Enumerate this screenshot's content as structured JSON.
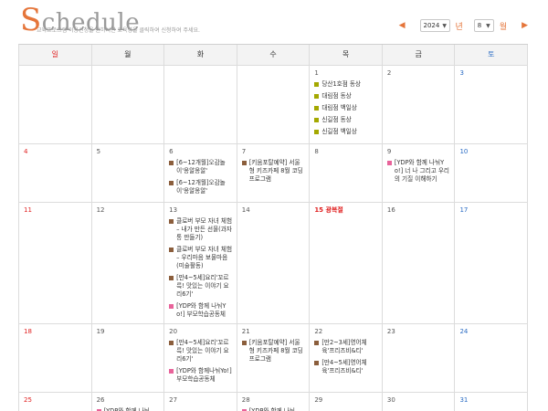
{
  "header": {
    "title_first": "S",
    "title_rest": "chedule",
    "subtitle": "교육프로그램 이용신청을 원하시면 교육명을 클릭하여 신청하여 주세요."
  },
  "nav": {
    "prev": "◀",
    "next": "▶",
    "year": "2024",
    "year_unit": "년",
    "month": "8",
    "month_unit": "월"
  },
  "weekdays": [
    "일",
    "월",
    "화",
    "수",
    "목",
    "금",
    "토"
  ],
  "weeks": [
    [
      {
        "day": "",
        "events": []
      },
      {
        "day": "",
        "events": []
      },
      {
        "day": "",
        "events": []
      },
      {
        "day": "",
        "events": []
      },
      {
        "day": "1",
        "events": [
          {
            "color": "c1",
            "text": "당산1호점 동상"
          },
          {
            "color": "c1",
            "text": "대림점 동상"
          },
          {
            "color": "c1",
            "text": "대림점 백일상"
          },
          {
            "color": "c1",
            "text": "신길점 동상"
          },
          {
            "color": "c1",
            "text": "신길점 백일상"
          }
        ]
      },
      {
        "day": "2",
        "events": []
      },
      {
        "day": "3",
        "events": []
      }
    ],
    [
      {
        "day": "4",
        "events": []
      },
      {
        "day": "5",
        "events": []
      },
      {
        "day": "6",
        "events": [
          {
            "color": "c2",
            "text": "[6~12개월]오감놀이'옹알옹알'"
          },
          {
            "color": "c2",
            "text": "[6~12개월]오감놀이'옹알옹알'"
          }
        ]
      },
      {
        "day": "7",
        "events": [
          {
            "color": "c2",
            "text": "[키움포탈예약] 서울형 키즈카페 8월 코딩 프로그램"
          }
        ]
      },
      {
        "day": "8",
        "events": []
      },
      {
        "day": "9",
        "events": [
          {
            "color": "c3",
            "text": "[YDP와 함께 나눠Yo!] 너 나 그리고 우리의 기질 이해하기"
          }
        ]
      },
      {
        "day": "10",
        "events": []
      }
    ],
    [
      {
        "day": "11",
        "events": []
      },
      {
        "day": "12",
        "events": []
      },
      {
        "day": "13",
        "events": [
          {
            "color": "c2",
            "text": "클로버 부모 자녀 체험 – 내가 만든 선물(과자통 만들기)"
          },
          {
            "color": "c2",
            "text": "클로버 부모 자녀 체험 – 우리마음 보물마음(미술활동)"
          },
          {
            "color": "c2",
            "text": "[만4~5세]요리'꼬르륵! 맛있는 이야기 요리6기'"
          },
          {
            "color": "c3",
            "text": "[YDP와 함께 나눠Yo!] 부모학습공동체"
          }
        ]
      },
      {
        "day": "14",
        "events": []
      },
      {
        "day": "15 광복절",
        "holiday": true,
        "events": []
      },
      {
        "day": "16",
        "events": []
      },
      {
        "day": "17",
        "events": []
      }
    ],
    [
      {
        "day": "18",
        "events": []
      },
      {
        "day": "19",
        "events": []
      },
      {
        "day": "20",
        "events": [
          {
            "color": "c2",
            "text": "[만4~5세]요리'꼬르륵! 맛있는 이야기 요리6기'"
          },
          {
            "color": "c3",
            "text": "[YDP와 함께나눠Yo!] 부모학습공동체"
          }
        ]
      },
      {
        "day": "21",
        "events": [
          {
            "color": "c2",
            "text": "[키움포탈예약] 서울형 키즈카페 8월 코딩 프로그램"
          }
        ]
      },
      {
        "day": "22",
        "events": [
          {
            "color": "c2",
            "text": "[만2~3세]영어체육'프리즈비&티'"
          },
          {
            "color": "c2",
            "text": "[만4~5세]영어체육'프리즈비&티'"
          }
        ]
      },
      {
        "day": "23",
        "events": []
      },
      {
        "day": "24",
        "events": []
      }
    ],
    [
      {
        "day": "25",
        "events": []
      },
      {
        "day": "26",
        "events": [
          {
            "color": "c3",
            "text": "[YDP와 함께 나눠"
          }
        ]
      },
      {
        "day": "27",
        "events": []
      },
      {
        "day": "28",
        "events": [
          {
            "color": "c3",
            "text": "[YDP와 함께 나눠"
          }
        ]
      },
      {
        "day": "29",
        "events": []
      },
      {
        "day": "30",
        "events": []
      },
      {
        "day": "31",
        "events": []
      }
    ]
  ]
}
